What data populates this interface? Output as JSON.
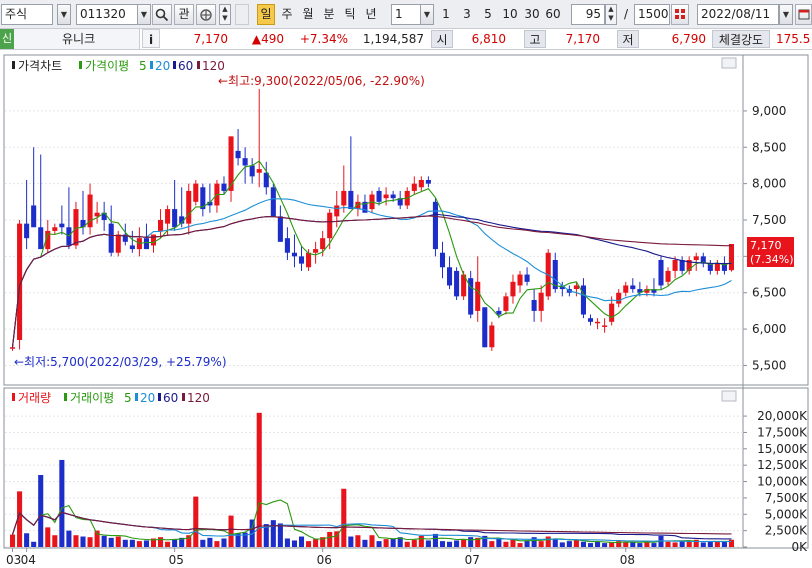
{
  "toolbar": {
    "market": "주식",
    "code": "011320",
    "search_icon": "search-icon",
    "gwan": "관",
    "periods": [
      "일",
      "주",
      "월",
      "분",
      "틱",
      "년"
    ],
    "active_period": "일",
    "interval_value": "1",
    "minute_buttons": [
      "1",
      "3",
      "5",
      "10",
      "30",
      "60"
    ],
    "count_value": "95",
    "total_value": "1500",
    "date_value": "2022/08/11"
  },
  "quote": {
    "badge": "신",
    "name": "유니크",
    "info_button": "i",
    "price": "7,170",
    "change": "▲490",
    "change_pct": "+7.34%",
    "volume": "1,194,587",
    "open_label": "시",
    "open": "6,810",
    "high_label": "고",
    "high": "7,170",
    "low_label": "저",
    "low": "6,790",
    "strength_label": "체결강도",
    "strength": "175.5"
  },
  "price_panel": {
    "legend_title": "가격차트",
    "legend_ma_label": "가격이평",
    "ma_periods": [
      "5",
      "20",
      "60",
      "120"
    ],
    "max_annotation": "←최고:9,300(2022/05/06, -22.90%)",
    "min_annotation": "←최저:5,700(2022/03/29, +25.79%)",
    "last_price_label": "7,170",
    "last_pct_label": "(7.34%)"
  },
  "volume_panel": {
    "legend_title": "거래량",
    "legend_ma_label": "거래이평",
    "ma_periods": [
      "5",
      "20",
      "60",
      "120"
    ]
  },
  "colors": {
    "up": "#e8141b",
    "down": "#1c2dc9",
    "ma5": "#2a9a10",
    "ma20": "#1c8fd6",
    "ma60": "#1a1a8c",
    "ma120": "#7a1b3b"
  },
  "chart_data": [
    {
      "type": "candlestick",
      "title": "가격차트",
      "x_month_labels": [
        "03",
        "04",
        "05",
        "06",
        "07",
        "08"
      ],
      "y_ticks": [
        "9,000",
        "8,500",
        "8,000",
        "7,500",
        "7,000",
        "6,500",
        "6,000",
        "5,500"
      ],
      "ylim": [
        5300,
        9700
      ],
      "candles": [
        {
          "o": 5750,
          "h": 5750,
          "l": 5700,
          "c": 5750
        },
        {
          "o": 5850,
          "h": 7500,
          "l": 5720,
          "c": 7450
        },
        {
          "o": 7450,
          "h": 8050,
          "l": 7100,
          "c": 7250
        },
        {
          "o": 7700,
          "h": 8500,
          "l": 7550,
          "c": 7400
        },
        {
          "o": 7400,
          "h": 8400,
          "l": 7100,
          "c": 7100
        },
        {
          "o": 7100,
          "h": 7500,
          "l": 7050,
          "c": 7350
        },
        {
          "o": 7350,
          "h": 7450,
          "l": 7300,
          "c": 7400
        },
        {
          "o": 7450,
          "h": 7700,
          "l": 7300,
          "c": 7400
        },
        {
          "o": 7400,
          "h": 7950,
          "l": 7100,
          "c": 7150
        },
        {
          "o": 7150,
          "h": 7750,
          "l": 7100,
          "c": 7650
        },
        {
          "o": 7500,
          "h": 7900,
          "l": 7300,
          "c": 7400
        },
        {
          "o": 7400,
          "h": 8000,
          "l": 7300,
          "c": 7850
        },
        {
          "o": 7550,
          "h": 7750,
          "l": 7450,
          "c": 7600
        },
        {
          "o": 7600,
          "h": 7750,
          "l": 7350,
          "c": 7500
        },
        {
          "o": 7450,
          "h": 7700,
          "l": 7000,
          "c": 7050
        },
        {
          "o": 7050,
          "h": 7350,
          "l": 7000,
          "c": 7300
        },
        {
          "o": 7300,
          "h": 7450,
          "l": 7150,
          "c": 7200
        },
        {
          "o": 7150,
          "h": 7350,
          "l": 7050,
          "c": 7100
        },
        {
          "o": 7100,
          "h": 7400,
          "l": 7000,
          "c": 7250
        },
        {
          "o": 7250,
          "h": 7450,
          "l": 7100,
          "c": 7100
        },
        {
          "o": 7150,
          "h": 7300,
          "l": 7050,
          "c": 7300
        },
        {
          "o": 7350,
          "h": 7650,
          "l": 7250,
          "c": 7500
        },
        {
          "o": 7450,
          "h": 7700,
          "l": 7300,
          "c": 7650
        },
        {
          "o": 7650,
          "h": 8050,
          "l": 7350,
          "c": 7400
        },
        {
          "o": 7550,
          "h": 7950,
          "l": 7400,
          "c": 7450
        },
        {
          "o": 7450,
          "h": 8000,
          "l": 7300,
          "c": 7900
        },
        {
          "o": 7750,
          "h": 8050,
          "l": 7700,
          "c": 8000
        },
        {
          "o": 7950,
          "h": 8000,
          "l": 7550,
          "c": 7650
        },
        {
          "o": 7750,
          "h": 8000,
          "l": 7600,
          "c": 7700
        },
        {
          "o": 7700,
          "h": 8050,
          "l": 7600,
          "c": 8000
        },
        {
          "o": 8000,
          "h": 8100,
          "l": 7850,
          "c": 7900
        },
        {
          "o": 7900,
          "h": 8650,
          "l": 7750,
          "c": 8650
        },
        {
          "o": 8450,
          "h": 8750,
          "l": 8250,
          "c": 8350
        },
        {
          "o": 8350,
          "h": 8500,
          "l": 8000,
          "c": 8250
        },
        {
          "o": 8250,
          "h": 8350,
          "l": 8000,
          "c": 8100
        },
        {
          "o": 8150,
          "h": 9300,
          "l": 7950,
          "c": 8200
        },
        {
          "o": 8150,
          "h": 8300,
          "l": 7850,
          "c": 7950
        },
        {
          "o": 7950,
          "h": 8000,
          "l": 7550,
          "c": 7550
        },
        {
          "o": 7550,
          "h": 7700,
          "l": 7200,
          "c": 7200
        },
        {
          "o": 7250,
          "h": 7400,
          "l": 6950,
          "c": 7050
        },
        {
          "o": 7050,
          "h": 7300,
          "l": 6850,
          "c": 7000
        },
        {
          "o": 7000,
          "h": 7150,
          "l": 6800,
          "c": 6900
        },
        {
          "o": 6850,
          "h": 7100,
          "l": 6800,
          "c": 7050
        },
        {
          "o": 7050,
          "h": 7200,
          "l": 6900,
          "c": 7100
        },
        {
          "o": 7100,
          "h": 7350,
          "l": 7000,
          "c": 7250
        },
        {
          "o": 7250,
          "h": 7650,
          "l": 7100,
          "c": 7600
        },
        {
          "o": 7550,
          "h": 7900,
          "l": 7400,
          "c": 7700
        },
        {
          "o": 7700,
          "h": 8250,
          "l": 7600,
          "c": 7900
        },
        {
          "o": 7900,
          "h": 8650,
          "l": 7800,
          "c": 7650
        },
        {
          "o": 7650,
          "h": 7850,
          "l": 7550,
          "c": 7750
        },
        {
          "o": 7750,
          "h": 7850,
          "l": 7600,
          "c": 7600
        },
        {
          "o": 7650,
          "h": 7900,
          "l": 7600,
          "c": 7850
        },
        {
          "o": 7900,
          "h": 7950,
          "l": 7700,
          "c": 7750
        },
        {
          "o": 7800,
          "h": 7950,
          "l": 7700,
          "c": 7850
        },
        {
          "o": 7850,
          "h": 7900,
          "l": 7750,
          "c": 7800
        },
        {
          "o": 7800,
          "h": 7900,
          "l": 7650,
          "c": 7700
        },
        {
          "o": 7700,
          "h": 7950,
          "l": 7650,
          "c": 7900
        },
        {
          "o": 7900,
          "h": 8100,
          "l": 7850,
          "c": 8000
        },
        {
          "o": 7950,
          "h": 8100,
          "l": 7900,
          "c": 8050
        },
        {
          "o": 8050,
          "h": 8100,
          "l": 7950,
          "c": 8000
        },
        {
          "o": 7750,
          "h": 7800,
          "l": 7000,
          "c": 7100
        },
        {
          "o": 7050,
          "h": 7200,
          "l": 6700,
          "c": 6850
        },
        {
          "o": 6850,
          "h": 7000,
          "l": 6550,
          "c": 6600
        },
        {
          "o": 6800,
          "h": 6850,
          "l": 6400,
          "c": 6450
        },
        {
          "o": 6450,
          "h": 6800,
          "l": 6400,
          "c": 6750
        },
        {
          "o": 6700,
          "h": 6800,
          "l": 6150,
          "c": 6200
        },
        {
          "o": 6250,
          "h": 7000,
          "l": 6100,
          "c": 6650
        },
        {
          "o": 6300,
          "h": 6300,
          "l": 5750,
          "c": 5750
        },
        {
          "o": 5750,
          "h": 6100,
          "l": 5700,
          "c": 6050
        },
        {
          "o": 6250,
          "h": 6300,
          "l": 6150,
          "c": 6200
        },
        {
          "o": 6250,
          "h": 6500,
          "l": 6200,
          "c": 6450
        },
        {
          "o": 6450,
          "h": 6750,
          "l": 6350,
          "c": 6650
        },
        {
          "o": 6600,
          "h": 6800,
          "l": 6500,
          "c": 6750
        },
        {
          "o": 6750,
          "h": 6850,
          "l": 6600,
          "c": 6650
        },
        {
          "o": 6400,
          "h": 6550,
          "l": 6100,
          "c": 6250
        },
        {
          "o": 6250,
          "h": 6600,
          "l": 6100,
          "c": 6500
        },
        {
          "o": 6450,
          "h": 7100,
          "l": 6400,
          "c": 7050
        },
        {
          "o": 6950,
          "h": 7050,
          "l": 6500,
          "c": 6550
        },
        {
          "o": 6600,
          "h": 6650,
          "l": 6450,
          "c": 6550
        },
        {
          "o": 6550,
          "h": 6600,
          "l": 6450,
          "c": 6500
        },
        {
          "o": 6550,
          "h": 6650,
          "l": 6450,
          "c": 6600
        },
        {
          "o": 6600,
          "h": 6700,
          "l": 6150,
          "c": 6200
        },
        {
          "o": 6150,
          "h": 6200,
          "l": 6050,
          "c": 6100
        },
        {
          "o": 6100,
          "h": 6150,
          "l": 6000,
          "c": 6100
        },
        {
          "o": 6050,
          "h": 6150,
          "l": 5950,
          "c": 6050
        },
        {
          "o": 6100,
          "h": 6450,
          "l": 6050,
          "c": 6350
        },
        {
          "o": 6350,
          "h": 6550,
          "l": 6300,
          "c": 6500
        },
        {
          "o": 6500,
          "h": 6650,
          "l": 6450,
          "c": 6600
        },
        {
          "o": 6600,
          "h": 6700,
          "l": 6500,
          "c": 6550
        },
        {
          "o": 6550,
          "h": 6650,
          "l": 6450,
          "c": 6500
        },
        {
          "o": 6500,
          "h": 6600,
          "l": 6450,
          "c": 6550
        },
        {
          "o": 6550,
          "h": 6700,
          "l": 6450,
          "c": 6500
        },
        {
          "o": 6950,
          "h": 7000,
          "l": 6550,
          "c": 6600
        },
        {
          "o": 6650,
          "h": 6850,
          "l": 6600,
          "c": 6800
        },
        {
          "o": 6800,
          "h": 7000,
          "l": 6700,
          "c": 6950
        },
        {
          "o": 6950,
          "h": 7000,
          "l": 6750,
          "c": 6800
        },
        {
          "o": 6800,
          "h": 7000,
          "l": 6750,
          "c": 6950
        },
        {
          "o": 6950,
          "h": 7050,
          "l": 6800,
          "c": 7000
        },
        {
          "o": 7000,
          "h": 7050,
          "l": 6850,
          "c": 6900
        },
        {
          "o": 6900,
          "h": 6950,
          "l": 6750,
          "c": 6800
        },
        {
          "o": 6800,
          "h": 6950,
          "l": 6750,
          "c": 6900
        },
        {
          "o": 6900,
          "h": 7000,
          "l": 6750,
          "c": 6800
        },
        {
          "o": 6810,
          "h": 7170,
          "l": 6790,
          "c": 7170
        }
      ],
      "series": [
        {
          "name": "5",
          "period": 5,
          "color": "#2a9a10"
        },
        {
          "name": "20",
          "period": 20,
          "color": "#1c8fd6"
        },
        {
          "name": "60",
          "period": 60,
          "color": "#1a1a8c"
        },
        {
          "name": "120",
          "period": 120,
          "color": "#7a1b3b"
        }
      ]
    },
    {
      "type": "bar",
      "title": "거래량",
      "y_ticks": [
        "20,000K",
        "17,500K",
        "15,000K",
        "12,500K",
        "10,000K",
        "7,500K",
        "5,000K",
        "2,500K",
        "0K"
      ],
      "ylim": [
        0,
        22000
      ],
      "unit": "K",
      "values": [
        1900,
        8500,
        2100,
        800,
        11000,
        3000,
        1800,
        13300,
        2500,
        1800,
        1600,
        1500,
        2500,
        1700,
        1400,
        1600,
        1100,
        1100,
        900,
        1000,
        1300,
        1500,
        800,
        1200,
        1400,
        1800,
        7700,
        1100,
        1400,
        900,
        1300,
        4800,
        2100,
        2200,
        4200,
        20500,
        3500,
        4100,
        3600,
        1300,
        1000,
        1600,
        900,
        1200,
        1500,
        2300,
        2400,
        8900,
        1600,
        1800,
        1100,
        1800,
        900,
        1200,
        1300,
        1500,
        800,
        1100,
        1700,
        1000,
        2000,
        900,
        800,
        1000,
        1200,
        1500,
        1400,
        1700,
        900,
        1300,
        800,
        1100,
        600,
        1000,
        1500,
        900,
        1600,
        1300,
        700,
        900,
        1100,
        800,
        600,
        800,
        600,
        700,
        900,
        800,
        700,
        600,
        900,
        600,
        1700,
        800,
        700,
        900,
        800,
        1100,
        700,
        800,
        900,
        800,
        1100
      ],
      "up_flags": [
        1,
        1,
        0,
        0,
        0,
        1,
        1,
        0,
        0,
        1,
        0,
        1,
        1,
        0,
        0,
        1,
        0,
        0,
        1,
        0,
        1,
        1,
        1,
        0,
        0,
        1,
        1,
        0,
        0,
        1,
        0,
        1,
        0,
        0,
        0,
        1,
        0,
        0,
        0,
        0,
        0,
        0,
        1,
        1,
        1,
        1,
        1,
        1,
        0,
        1,
        0,
        1,
        0,
        1,
        0,
        0,
        1,
        1,
        1,
        0,
        0,
        0,
        0,
        0,
        1,
        0,
        1,
        0,
        1,
        0,
        1,
        1,
        1,
        0,
        0,
        1,
        1,
        0,
        0,
        0,
        1,
        0,
        0,
        0,
        0,
        1,
        1,
        1,
        0,
        0,
        1,
        0,
        0,
        1,
        1,
        0,
        1,
        1,
        0,
        0,
        1,
        0,
        1
      ],
      "series": [
        {
          "name": "5",
          "period": 5,
          "color": "#2a9a10"
        },
        {
          "name": "20",
          "period": 20,
          "color": "#1c8fd6"
        },
        {
          "name": "60",
          "period": 60,
          "color": "#1a1a8c"
        },
        {
          "name": "120",
          "period": 120,
          "color": "#7a1b3b"
        }
      ]
    }
  ]
}
